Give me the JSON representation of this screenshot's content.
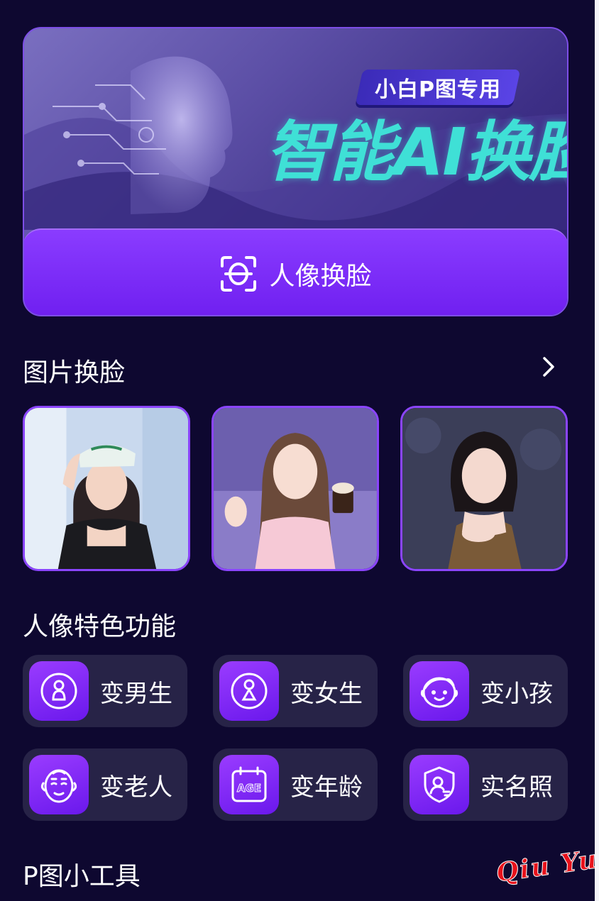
{
  "banner": {
    "subtitle": "小白P图专用",
    "title": "智能AI换脸",
    "button_label": "人像换脸"
  },
  "photo_section": {
    "title": "图片换脸"
  },
  "features_section": {
    "title": "人像特色功能",
    "items": [
      {
        "label": "变男生",
        "icon": "male-icon"
      },
      {
        "label": "变女生",
        "icon": "female-icon"
      },
      {
        "label": "变小孩",
        "icon": "child-face-icon"
      },
      {
        "label": "变老人",
        "icon": "old-face-icon"
      },
      {
        "label": "变年龄",
        "icon": "age-calendar-icon"
      },
      {
        "label": "实名照",
        "icon": "id-photo-icon"
      }
    ]
  },
  "tools_section": {
    "title": "P图小工具"
  },
  "watermark": "Qiu Yue",
  "colors": {
    "background": "#0e0830",
    "accent_purple": "#7a22f5",
    "tile_bg": "#272347",
    "title_cyan": "#3fe0d6"
  }
}
